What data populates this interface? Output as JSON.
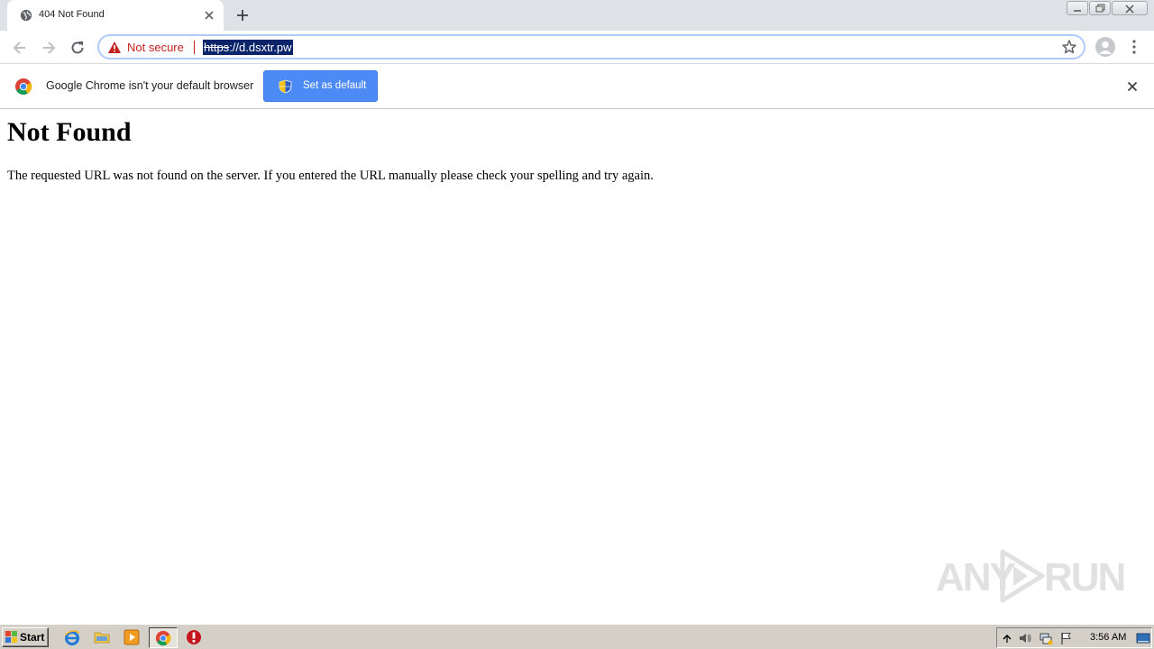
{
  "tab": {
    "title": "404 Not Found"
  },
  "omnibox": {
    "security_label": "Not secure",
    "url_scheme": "https",
    "url_rest": "://d.dsxtr.pw"
  },
  "infobar": {
    "message": "Google Chrome isn't your default browser",
    "button_label": "Set as default"
  },
  "page": {
    "heading": "Not Found",
    "message": "The requested URL was not found on the server. If you entered the URL manually please check your spelling and try again."
  },
  "watermark": {
    "left": "ANY",
    "right": "RUN"
  },
  "taskbar": {
    "start_label": "Start",
    "clock": "3:56 AM"
  },
  "colors": {
    "warning_red": "#c5221f",
    "button_blue": "#4c8bf5",
    "url_highlight": "#0a246a"
  }
}
